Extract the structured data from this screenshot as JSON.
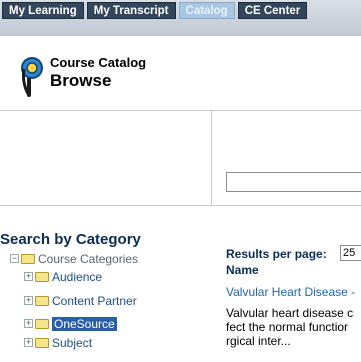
{
  "nav": {
    "tabs": [
      {
        "label": "My Learning",
        "active": false
      },
      {
        "label": "My Transcript",
        "active": false
      },
      {
        "label": "Catalog",
        "active": true
      },
      {
        "label": "CE Center",
        "active": false
      }
    ]
  },
  "header": {
    "logo_icon": "p-logo-icon",
    "title": "Course Catalog",
    "subtitle": "Browse"
  },
  "search": {
    "value": ""
  },
  "category": {
    "heading": "Search by Category",
    "root": "Course Categories",
    "items": [
      "Audience",
      "Content Partner",
      "OneSource",
      "Subject"
    ],
    "selected": "OneSource"
  },
  "results": {
    "per_page_label": "Results per page:",
    "per_page_value": "25",
    "column_name": "Name",
    "items": [
      {
        "title": "Valvular Heart Disease -",
        "description_lines": [
          "Valvular heart disease c",
          "fect the normal functior",
          "rgical inter..."
        ]
      }
    ]
  },
  "colors": {
    "nav_bg": "#34465c",
    "active_tab": "#a9c6e3",
    "link": "#1f66b3",
    "heading": "#0b2d55",
    "selected": "#2a5fa8"
  }
}
